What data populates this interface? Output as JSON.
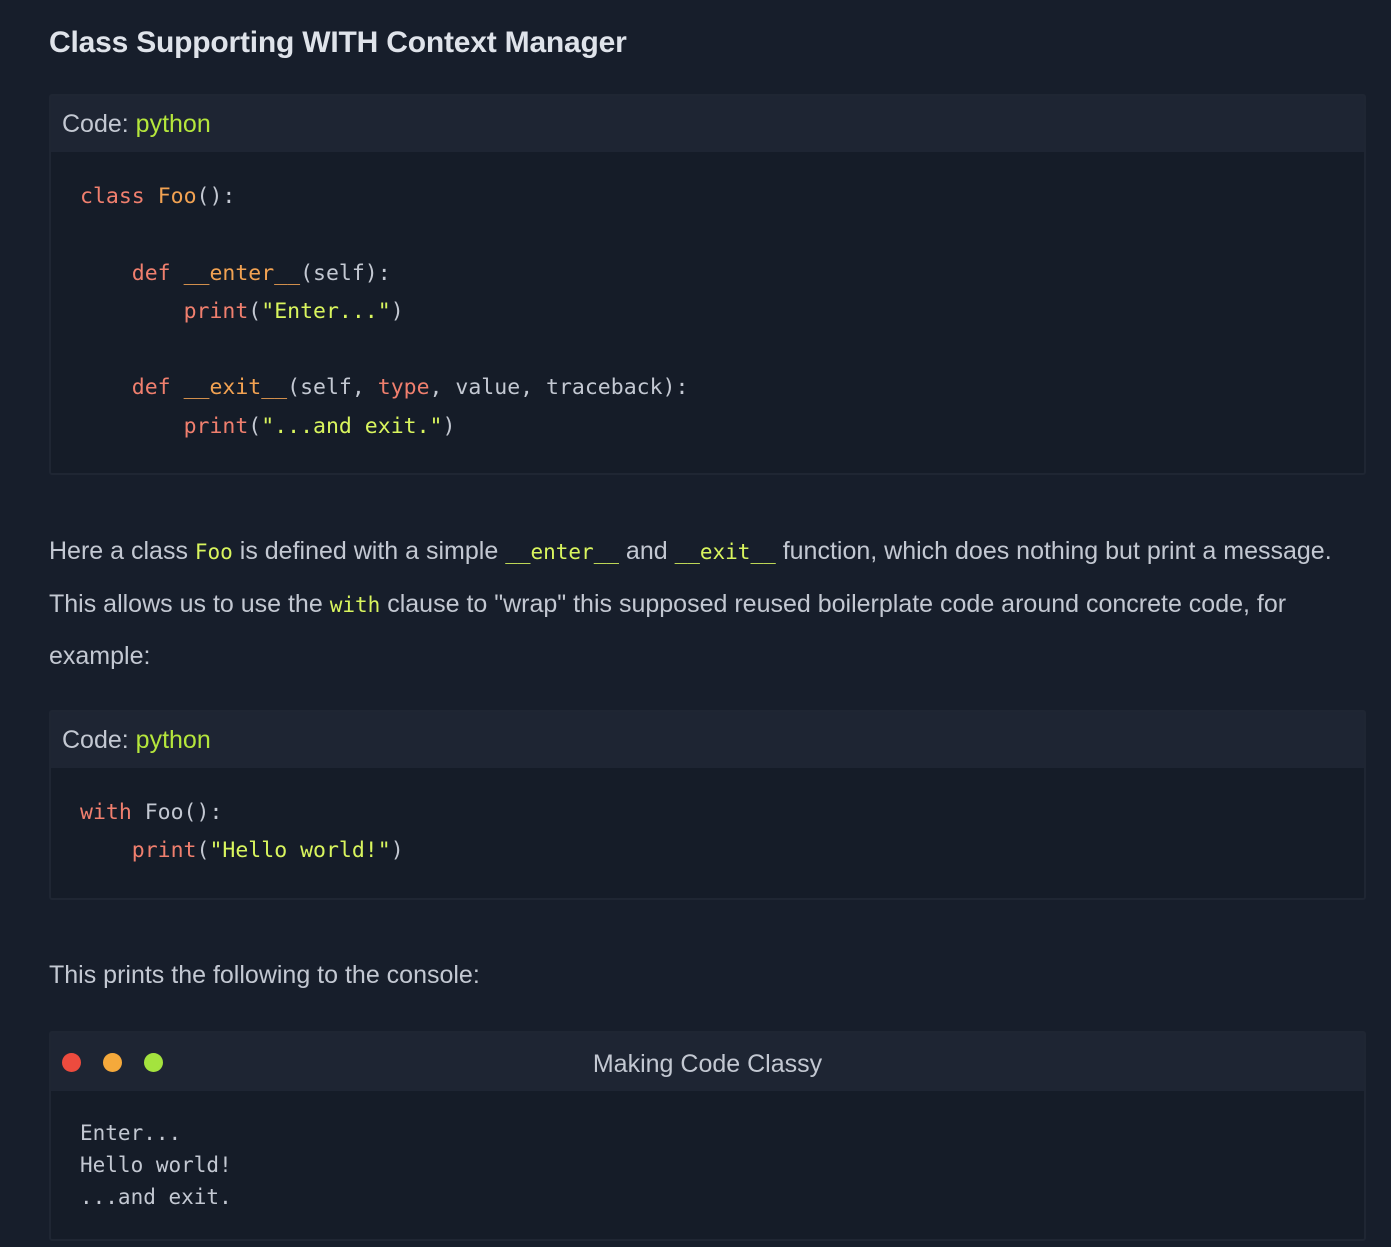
{
  "heading": "Class Supporting WITH Context Manager",
  "code_blocks": [
    {
      "label": "Code:",
      "language": "python",
      "lines": [
        {
          "tokens": [
            {
              "t": "class",
              "c": "kw"
            },
            {
              "t": " "
            },
            {
              "t": "Foo",
              "c": "fn"
            },
            {
              "t": "():"
            }
          ]
        },
        {
          "tokens": []
        },
        {
          "tokens": [
            {
              "t": "    "
            },
            {
              "t": "def",
              "c": "kw"
            },
            {
              "t": " "
            },
            {
              "t": "__enter__",
              "c": "fn"
            },
            {
              "t": "(self):"
            }
          ]
        },
        {
          "tokens": [
            {
              "t": "        "
            },
            {
              "t": "print",
              "c": "builtin"
            },
            {
              "t": "("
            },
            {
              "t": "\"Enter...\"",
              "c": "str"
            },
            {
              "t": ")"
            }
          ]
        },
        {
          "tokens": []
        },
        {
          "tokens": [
            {
              "t": "    "
            },
            {
              "t": "def",
              "c": "kw"
            },
            {
              "t": " "
            },
            {
              "t": "__exit__",
              "c": "fn"
            },
            {
              "t": "(self, "
            },
            {
              "t": "type",
              "c": "builtin"
            },
            {
              "t": ", value, traceback):"
            }
          ]
        },
        {
          "tokens": [
            {
              "t": "        "
            },
            {
              "t": "print",
              "c": "builtin"
            },
            {
              "t": "("
            },
            {
              "t": "\"...and exit.\"",
              "c": "str"
            },
            {
              "t": ")"
            }
          ]
        }
      ]
    },
    {
      "label": "Code:",
      "language": "python",
      "lines": [
        {
          "tokens": [
            {
              "t": "with",
              "c": "kw"
            },
            {
              "t": " Foo():"
            }
          ]
        },
        {
          "tokens": [
            {
              "t": "    "
            },
            {
              "t": "print",
              "c": "builtin"
            },
            {
              "t": "("
            },
            {
              "t": "\"Hello world!\"",
              "c": "str"
            },
            {
              "t": ")"
            }
          ]
        }
      ]
    }
  ],
  "paragraph1": {
    "p1": "Here a class ",
    "c1": "Foo",
    "p2": " is defined with a simple ",
    "c2": "__enter__",
    "p3": " and ",
    "c3": "__exit__",
    "p4": " function, which does nothing but print a message. This allows us to use the ",
    "c4": "with",
    "p5": " clause to \"wrap\" this supposed reused boilerplate code around concrete code, for example:"
  },
  "paragraph2": "This prints the following to the console:",
  "terminal": {
    "title": "Making Code Classy",
    "output": "Enter...\nHello world!\n...and exit."
  },
  "colors": {
    "background": "#171e2b",
    "keyword": "#f07f6e",
    "function": "#f2a252",
    "string": "#d9f55e",
    "language": "#b5e63c"
  }
}
